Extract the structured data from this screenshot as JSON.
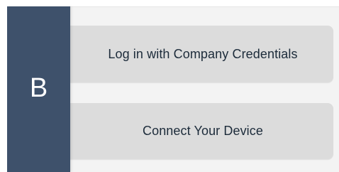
{
  "logo": {
    "letter": "B",
    "color": "#3e516b"
  },
  "options": [
    {
      "label": "Log in with Company Credentials"
    },
    {
      "label": "Connect Your Device"
    }
  ]
}
